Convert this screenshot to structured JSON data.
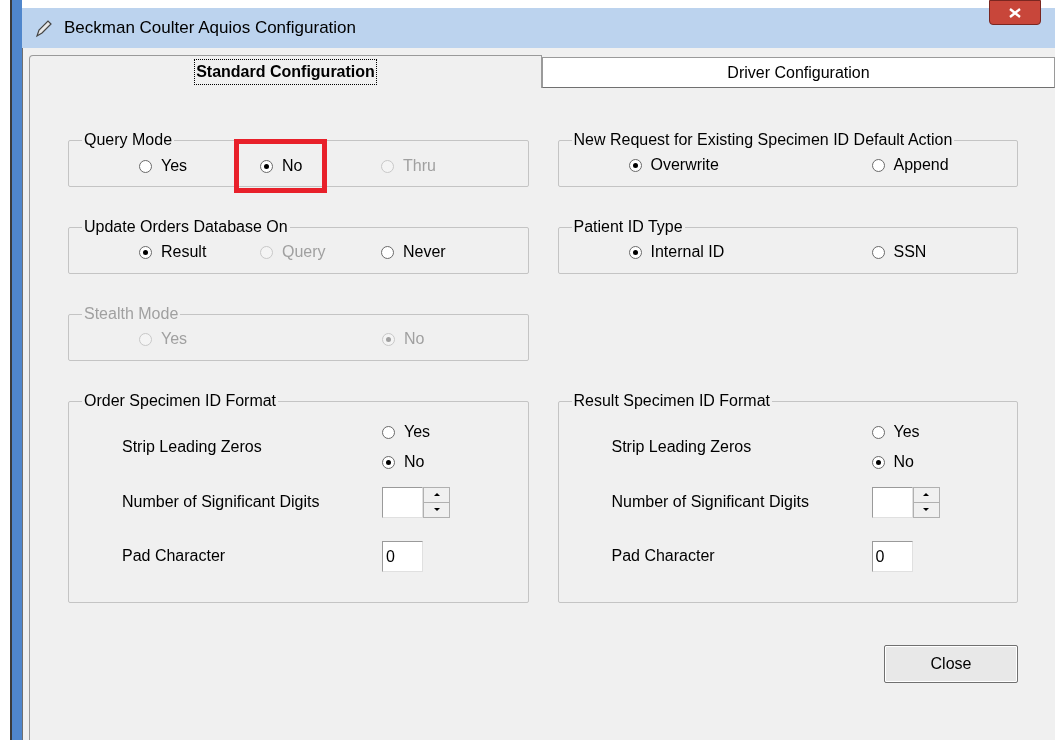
{
  "window": {
    "title": "Beckman Coulter Aquios Configuration"
  },
  "tabs": [
    {
      "label": "Standard Configuration",
      "selected": true
    },
    {
      "label": "Driver Configuration",
      "selected": false
    }
  ],
  "group_rows": [
    [
      {
        "kind": "radio",
        "title": "Query Mode",
        "disabled": false,
        "options": [
          {
            "label": "Yes",
            "selected": false,
            "disabled": false
          },
          {
            "label": "No",
            "selected": true,
            "disabled": false,
            "highlighted": true
          },
          {
            "label": "Thru",
            "selected": false,
            "disabled": true
          }
        ]
      },
      {
        "kind": "radio",
        "title": "New Request for Existing Specimen ID Default Action",
        "disabled": false,
        "options": [
          {
            "label": "Overwrite",
            "selected": true,
            "disabled": false
          },
          {
            "label": "Append",
            "selected": false,
            "disabled": false
          }
        ]
      }
    ],
    [
      {
        "kind": "radio",
        "title": "Update Orders Database On",
        "disabled": false,
        "options": [
          {
            "label": "Result",
            "selected": true,
            "disabled": false
          },
          {
            "label": "Query",
            "selected": false,
            "disabled": true
          },
          {
            "label": "Never",
            "selected": false,
            "disabled": false
          }
        ]
      },
      {
        "kind": "radio",
        "title": "Patient ID Type",
        "disabled": false,
        "options": [
          {
            "label": "Internal ID",
            "selected": true,
            "disabled": false
          },
          {
            "label": "SSN",
            "selected": false,
            "disabled": false
          }
        ]
      }
    ],
    [
      {
        "kind": "radio",
        "title": "Stealth Mode",
        "disabled": true,
        "options": [
          {
            "label": "Yes",
            "selected": false
          },
          {
            "label": "No",
            "selected": true
          }
        ]
      }
    ],
    [
      {
        "kind": "format",
        "title": "Order Specimen ID Format",
        "rows": [
          {
            "kind": "radio",
            "label": "Strip Leading Zeros",
            "options": [
              {
                "label": "Yes",
                "selected": false
              },
              {
                "label": "No",
                "selected": true
              }
            ]
          },
          {
            "kind": "spinner",
            "label": "Number of Significant Digits"
          },
          {
            "kind": "text",
            "label": "Pad Character",
            "value": "0"
          }
        ]
      },
      {
        "kind": "format",
        "title": "Result Specimen ID Format",
        "rows": [
          {
            "kind": "radio",
            "label": "Strip Leading Zeros",
            "options": [
              {
                "label": "Yes",
                "selected": false
              },
              {
                "label": "No",
                "selected": true
              }
            ]
          },
          {
            "kind": "spinner",
            "label": "Number of Significant Digits"
          },
          {
            "kind": "text",
            "label": "Pad Character",
            "value": "0"
          }
        ]
      }
    ]
  ],
  "buttons": [
    {
      "label": "Close"
    }
  ]
}
